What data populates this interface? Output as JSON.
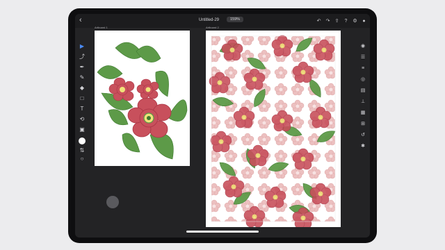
{
  "document": {
    "title": "Untitled-29",
    "zoom": "159%"
  },
  "artboards": [
    {
      "label": "Artboard 1"
    },
    {
      "label": "Artboard 2"
    }
  ],
  "left_tools": [
    {
      "name": "selection-tool",
      "icon": "arrow-icon",
      "active": true
    },
    {
      "name": "direct-selection-tool",
      "icon": "direct-select-icon"
    },
    {
      "name": "pen-tool",
      "icon": "pen-icon"
    },
    {
      "name": "pencil-tool",
      "icon": "pencil-icon"
    },
    {
      "name": "eraser-tool",
      "icon": "eraser-icon"
    },
    {
      "name": "shape-tool",
      "icon": "rectangle-icon"
    },
    {
      "name": "type-tool",
      "icon": "type-icon"
    },
    {
      "name": "transform-tool",
      "icon": "transform-icon"
    },
    {
      "name": "image-tool",
      "icon": "image-icon"
    }
  ],
  "right_tools": [
    "layers-icon",
    "properties-icon",
    "appearance-icon",
    "align-icon",
    "pathfinder-icon",
    "glyphs-icon",
    "history-icon",
    "settings-icon"
  ],
  "colors": {
    "petal": "#c8505c",
    "petal_dark": "#a93545",
    "leaf": "#5d9a48",
    "leaf_dark": "#3f7a30",
    "center": "#f0e27a",
    "pattern_pale": "#e9b3b3",
    "accent": "#4a8af4"
  }
}
